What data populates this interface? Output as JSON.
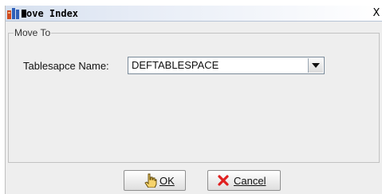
{
  "window": {
    "title": "ove Index",
    "close_glyph": "X"
  },
  "group": {
    "label": "Move To"
  },
  "tablespace": {
    "label": "Tablesapce Name:",
    "value": "DEFTABLESPACE"
  },
  "buttons": {
    "ok_label": "OK",
    "cancel_label": "Cancel"
  },
  "icons": {
    "app": "database-icon",
    "dropdown": "chevron-down-icon",
    "ok": "hand-pointer-icon",
    "cancel": "red-x-icon"
  }
}
